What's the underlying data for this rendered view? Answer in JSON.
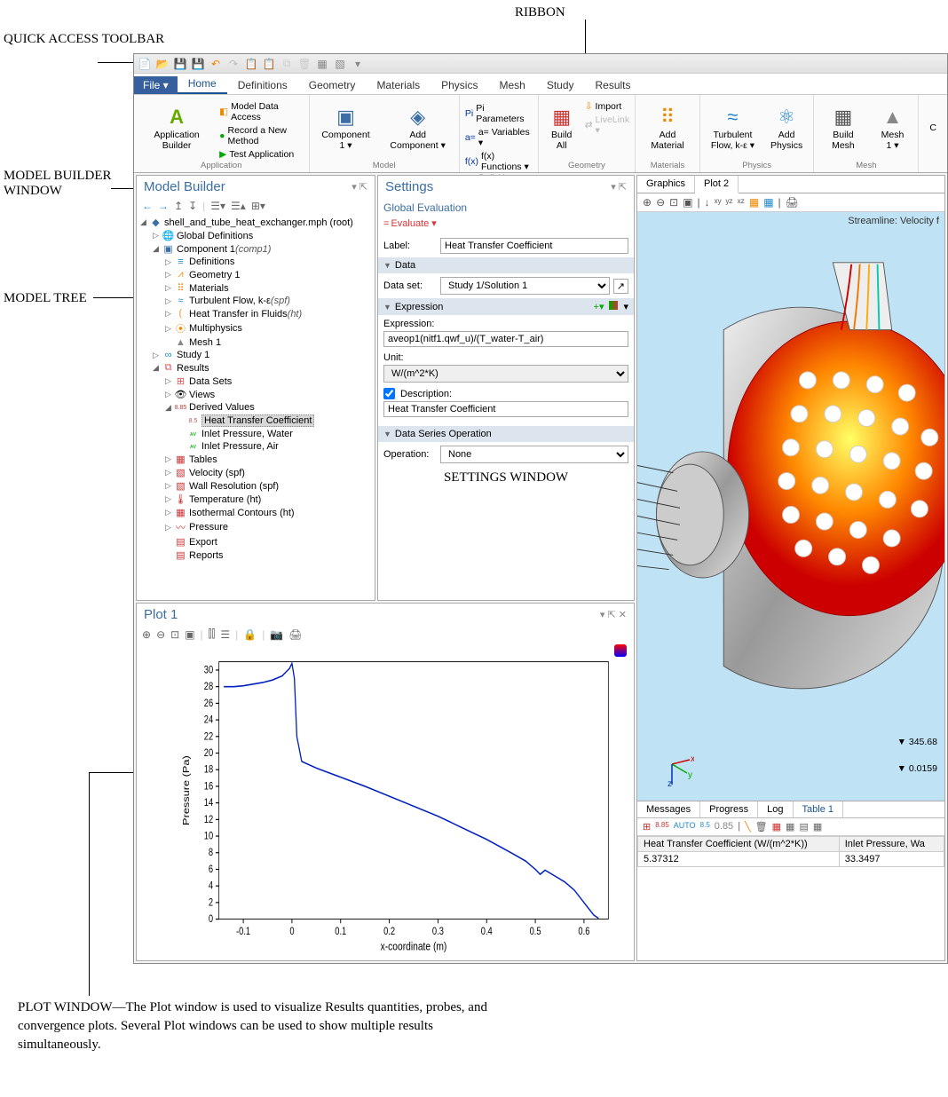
{
  "annotations": {
    "qat": "QUICK ACCESS TOOLBAR",
    "ribbon": "RIBBON",
    "mbwindow": "MODEL BUILDER WINDOW",
    "mtree": "MODEL TREE",
    "settings": "SETTINGS WINDOW",
    "plot_caption": "PLOT WINDOW—The Plot window is used to visualize Results quantities, probes, and convergence plots. Several Plot windows can be used to show multiple results simultaneously."
  },
  "ribbon": {
    "file": "File ▾",
    "tabs": [
      "Home",
      "Definitions",
      "Geometry",
      "Materials",
      "Physics",
      "Mesh",
      "Study",
      "Results"
    ],
    "active_tab": "Home",
    "groups": {
      "application": {
        "label": "Application",
        "big": "Application Builder",
        "items": [
          "Model Data Access",
          "Record a New Method",
          "Test Application"
        ]
      },
      "model": {
        "label": "Model",
        "big1": "Component 1 ▾",
        "big2": "Add Component ▾"
      },
      "definitions": {
        "label": "Definitions",
        "items": [
          "Pi Parameters",
          "a= Variables ▾",
          "f(x) Functions ▾"
        ]
      },
      "geometry": {
        "label": "Geometry",
        "big": "Build All",
        "items": [
          "Import",
          "LiveLink ▾"
        ]
      },
      "materials": {
        "label": "Materials",
        "big": "Add Material"
      },
      "physics": {
        "label": "Physics",
        "big1": "Turbulent\nFlow, k-ε ▾",
        "big2": "Add Physics"
      },
      "mesh": {
        "label": "Mesh",
        "big1": "Build Mesh",
        "big2": "Mesh 1 ▾"
      }
    }
  },
  "model_builder": {
    "title": "Model Builder",
    "root": "shell_and_tube_heat_exchanger.mph (root)",
    "items": [
      {
        "ind": 1,
        "twist": "▷",
        "icon": "🌐",
        "label": "Global Definitions"
      },
      {
        "ind": 1,
        "twist": "◢",
        "icon": "▣",
        "label": "Component 1 ",
        "suffix": "(comp1)",
        "iconc": "#3a6ea5"
      },
      {
        "ind": 2,
        "twist": "▷",
        "icon": "≡",
        "label": "Definitions",
        "iconc": "#28c"
      },
      {
        "ind": 2,
        "twist": "▷",
        "icon": "⩘",
        "label": "Geometry 1",
        "iconc": "#e80"
      },
      {
        "ind": 2,
        "twist": "▷",
        "icon": "⠿",
        "label": "Materials",
        "iconc": "#e80"
      },
      {
        "ind": 2,
        "twist": "▷",
        "icon": "≈",
        "label": "Turbulent Flow, k-ε ",
        "suffix": "(spf)",
        "iconc": "#28c"
      },
      {
        "ind": 2,
        "twist": "▷",
        "icon": "⟮",
        "label": "Heat Transfer in Fluids ",
        "suffix": "(ht)",
        "iconc": "#e80"
      },
      {
        "ind": 2,
        "twist": "▷",
        "icon": "⦿",
        "label": "Multiphysics",
        "iconc": "#e80"
      },
      {
        "ind": 2,
        "twist": "",
        "icon": "▲",
        "label": "Mesh 1",
        "iconc": "#888"
      },
      {
        "ind": 1,
        "twist": "▷",
        "icon": "∞",
        "label": "Study 1",
        "iconc": "#28c"
      },
      {
        "ind": 1,
        "twist": "◢",
        "icon": "⧉",
        "label": "Results",
        "iconc": "#d55"
      },
      {
        "ind": 2,
        "twist": "▷",
        "icon": "⊞",
        "label": "Data Sets",
        "iconc": "#d55"
      },
      {
        "ind": 2,
        "twist": "▷",
        "icon": "👁",
        "label": "Views"
      },
      {
        "ind": 2,
        "twist": "◢",
        "icon": "8.85",
        "label": "Derived Values",
        "iconc": "#c33",
        "tiny": true
      },
      {
        "ind": 3,
        "twist": "",
        "icon": "8.5",
        "label": "Heat Transfer Coefficient",
        "sel": true,
        "iconc": "#c55",
        "tiny": true
      },
      {
        "ind": 3,
        "twist": "",
        "icon": "ᴀᴠ",
        "label": "Inlet Pressure, Water",
        "iconc": "#0a0",
        "tiny": true
      },
      {
        "ind": 3,
        "twist": "",
        "icon": "ᴀᴠ",
        "label": "Inlet Pressure, Air",
        "iconc": "#0a0",
        "tiny": true
      },
      {
        "ind": 2,
        "twist": "▷",
        "icon": "▦",
        "label": "Tables",
        "iconc": "#c33"
      },
      {
        "ind": 2,
        "twist": "▷",
        "icon": "▧",
        "label": "Velocity (spf)",
        "iconc": "#c33"
      },
      {
        "ind": 2,
        "twist": "▷",
        "icon": "▧",
        "label": "Wall Resolution (spf)",
        "iconc": "#c33"
      },
      {
        "ind": 2,
        "twist": "▷",
        "icon": "🌡",
        "label": "Temperature (ht)",
        "iconc": "#c33"
      },
      {
        "ind": 2,
        "twist": "▷",
        "icon": "▦",
        "label": "Isothermal Contours (ht)",
        "iconc": "#c33"
      },
      {
        "ind": 2,
        "twist": "▷",
        "icon": "〰",
        "label": "Pressure",
        "iconc": "#c33"
      },
      {
        "ind": 2,
        "twist": "",
        "icon": "▤",
        "label": "Export",
        "iconc": "#c33"
      },
      {
        "ind": 2,
        "twist": "",
        "icon": "▤",
        "label": "Reports",
        "iconc": "#c33"
      }
    ]
  },
  "settings": {
    "title": "Settings",
    "subtitle": "Global Evaluation",
    "evaluate": "Evaluate  ▾",
    "label_label": "Label:",
    "label_value": "Heat Transfer Coefficient",
    "sec_data": "Data",
    "dataset_label": "Data set:",
    "dataset_value": "Study 1/Solution 1",
    "sec_expr": "Expression",
    "expr_label": "Expression:",
    "expr_value": "aveop1(nitf1.qwf_u)/(T_water-T_air)",
    "unit_label": "Unit:",
    "unit_value": "W/(m^2*K)",
    "desc_check": true,
    "desc_label": "Description:",
    "desc_value": "Heat Transfer Coefficient",
    "sec_dso": "Data Series Operation",
    "op_label": "Operation:",
    "op_value": "None"
  },
  "graphics": {
    "tabs": [
      "Graphics",
      "Plot 2"
    ],
    "active": "Plot 2",
    "caption": "Streamline: Velocity f",
    "legend_vals": [
      "345.68",
      "0.0159"
    ]
  },
  "plot": {
    "title": "Plot 1",
    "ylabel": "Pressure (Pa)",
    "xlabel": "x-coordinate (m)"
  },
  "chart_data": {
    "type": "line",
    "title": "",
    "xlabel": "x-coordinate (m)",
    "ylabel": "Pressure (Pa)",
    "xlim": [
      -0.15,
      0.65
    ],
    "ylim": [
      0,
      31
    ],
    "xticks": [
      -0.1,
      0,
      0.1,
      0.2,
      0.3,
      0.4,
      0.5,
      0.6
    ],
    "yticks": [
      0,
      2,
      4,
      6,
      8,
      10,
      12,
      14,
      16,
      18,
      20,
      22,
      24,
      26,
      28,
      30
    ],
    "series": [
      {
        "name": "Pressure",
        "x": [
          -0.14,
          -0.12,
          -0.1,
          -0.08,
          -0.06,
          -0.04,
          -0.02,
          -0.005,
          0.0,
          0.005,
          0.01,
          0.02,
          0.05,
          0.1,
          0.15,
          0.2,
          0.25,
          0.3,
          0.35,
          0.4,
          0.45,
          0.48,
          0.5,
          0.51,
          0.52,
          0.54,
          0.56,
          0.58,
          0.6,
          0.62,
          0.63
        ],
        "y": [
          28.0,
          28.0,
          28.1,
          28.3,
          28.5,
          28.8,
          29.3,
          30.2,
          30.8,
          29.0,
          22.0,
          19.0,
          18.2,
          17.1,
          16.0,
          14.8,
          13.6,
          12.4,
          11.0,
          9.6,
          8.0,
          7.0,
          6.0,
          5.4,
          5.9,
          5.2,
          4.5,
          3.5,
          2.0,
          0.5,
          0.1
        ]
      }
    ]
  },
  "bottom": {
    "tabs": [
      "Messages",
      "Progress",
      "Log",
      "Table 1"
    ],
    "active": "Table 1",
    "columns": [
      "Heat Transfer Coefficient (W/(m^2*K))",
      "Inlet Pressure, Wa"
    ],
    "row": [
      "5.37312",
      "33.3497"
    ]
  }
}
